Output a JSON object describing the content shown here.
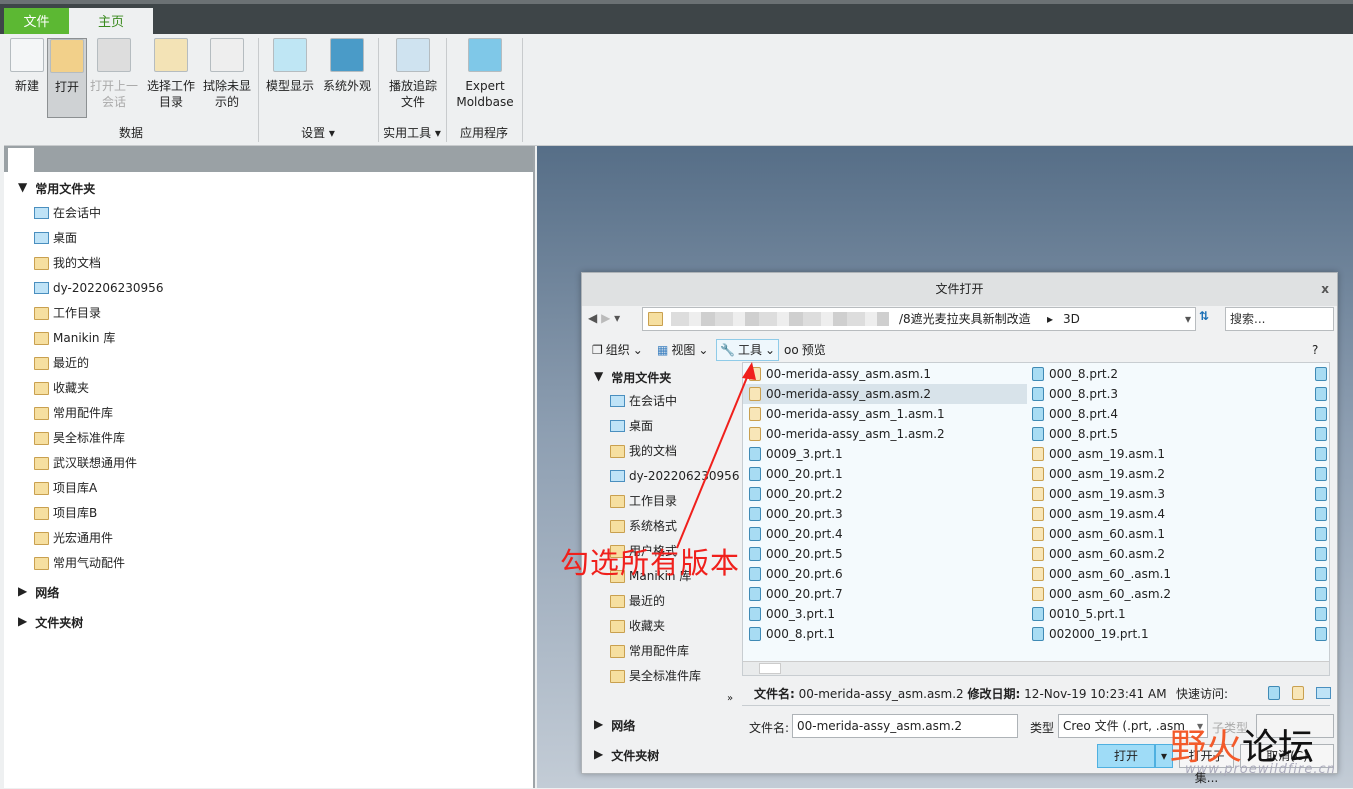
{
  "tabs": {
    "file": "文件",
    "home": "主页"
  },
  "ribbon": {
    "buttons": [
      {
        "label": "新建",
        "state": "normal"
      },
      {
        "label": "打开",
        "state": "active"
      },
      {
        "label": "打开上一会话",
        "state": "disabled"
      },
      {
        "label": "选择工作目录",
        "state": "normal"
      },
      {
        "label": "拭除未显示的",
        "state": "normal"
      },
      {
        "label": "模型显示",
        "state": "normal"
      },
      {
        "label": "系统外观",
        "state": "normal"
      },
      {
        "label": "播放追踪文件",
        "state": "normal"
      },
      {
        "label": "Expert Moldbase",
        "state": "normal"
      }
    ],
    "groups": [
      "数据",
      "设置 ▾",
      "实用工具 ▾",
      "应用程序"
    ]
  },
  "left_panel": {
    "section_common": "常用文件夹",
    "items": [
      "在会话中",
      "桌面",
      "我的文档",
      "dy-202206230956",
      "工作目录",
      "Manikin 库",
      "最近的",
      "收藏夹",
      "常用配件库",
      "昊全标准件库",
      "武汉联想通用件",
      "项目库A",
      "项目库B",
      "光宏通用件",
      "常用气动配件"
    ],
    "section_network": "网络",
    "section_tree": "文件夹树"
  },
  "dialog": {
    "title": "文件打开",
    "close": "x",
    "path": "/8遮光麦拉夹具新制改造",
    "path_sep": "▸",
    "path_last": "3D",
    "search_placeholder": "搜索...",
    "toolbar": {
      "organize": "组织",
      "view": "视图",
      "tools": "工具",
      "preview": "预览",
      "help": "?"
    },
    "sidebar": {
      "section_common": "常用文件夹",
      "items": [
        "在会话中",
        "桌面",
        "我的文档",
        "dy-202206230956",
        "工作目录",
        "系统格式",
        "用户格式",
        "Manikin 库",
        "最近的",
        "收藏夹",
        "常用配件库",
        "昊全标准件库"
      ],
      "more": "»",
      "section_network": "网络",
      "section_tree": "文件夹树"
    },
    "files_col1": [
      {
        "name": "00-merida-assy_asm.asm.1",
        "type": "asm"
      },
      {
        "name": "00-merida-assy_asm.asm.2",
        "type": "asm",
        "selected": true
      },
      {
        "name": "00-merida-assy_asm_1.asm.1",
        "type": "asm"
      },
      {
        "name": "00-merida-assy_asm_1.asm.2",
        "type": "asm"
      },
      {
        "name": "0009_3.prt.1",
        "type": "prt"
      },
      {
        "name": "000_20.prt.1",
        "type": "prt"
      },
      {
        "name": "000_20.prt.2",
        "type": "prt"
      },
      {
        "name": "000_20.prt.3",
        "type": "prt"
      },
      {
        "name": "000_20.prt.4",
        "type": "prt"
      },
      {
        "name": "000_20.prt.5",
        "type": "prt"
      },
      {
        "name": "000_20.prt.6",
        "type": "prt"
      },
      {
        "name": "000_20.prt.7",
        "type": "prt"
      },
      {
        "name": "000_3.prt.1",
        "type": "prt"
      },
      {
        "name": "000_8.prt.1",
        "type": "prt"
      }
    ],
    "files_col2": [
      {
        "name": "000_8.prt.2",
        "type": "prt"
      },
      {
        "name": "000_8.prt.3",
        "type": "prt"
      },
      {
        "name": "000_8.prt.4",
        "type": "prt"
      },
      {
        "name": "000_8.prt.5",
        "type": "prt"
      },
      {
        "name": "000_asm_19.asm.1",
        "type": "asm"
      },
      {
        "name": "000_asm_19.asm.2",
        "type": "asm"
      },
      {
        "name": "000_asm_19.asm.3",
        "type": "asm"
      },
      {
        "name": "000_asm_19.asm.4",
        "type": "asm"
      },
      {
        "name": "000_asm_60.asm.1",
        "type": "asm"
      },
      {
        "name": "000_asm_60.asm.2",
        "type": "asm"
      },
      {
        "name": "000_asm_60_.asm.1",
        "type": "asm"
      },
      {
        "name": "000_asm_60_.asm.2",
        "type": "asm"
      },
      {
        "name": "0010_5.prt.1",
        "type": "prt"
      },
      {
        "name": "002000_19.prt.1",
        "type": "prt"
      }
    ],
    "info": {
      "filename_label": "文件名:",
      "filename": "00-merida-assy_asm.asm.2",
      "date_label": "修改日期:",
      "date": "12-Nov-19 10:23:41 AM",
      "quick_access": "快速访问:"
    },
    "form": {
      "filename_label": "文件名:",
      "filename_value": "00-merida-assy_asm.asm.2",
      "type_label": "类型",
      "type_value": "Creo 文件 (.prt, .asm",
      "subtype_label": "子类型"
    },
    "buttons": {
      "open": "打开",
      "open_subset": "打开子集...",
      "cancel": "取消(C)"
    }
  },
  "annotation": "勾选所有版本",
  "watermark": {
    "text": "野火论坛",
    "url": "www.proewildfire.cn"
  },
  "colors": {
    "file_tab": "#5cb833",
    "annotation": "#f0201c",
    "open_button": "#9fdcf7"
  }
}
